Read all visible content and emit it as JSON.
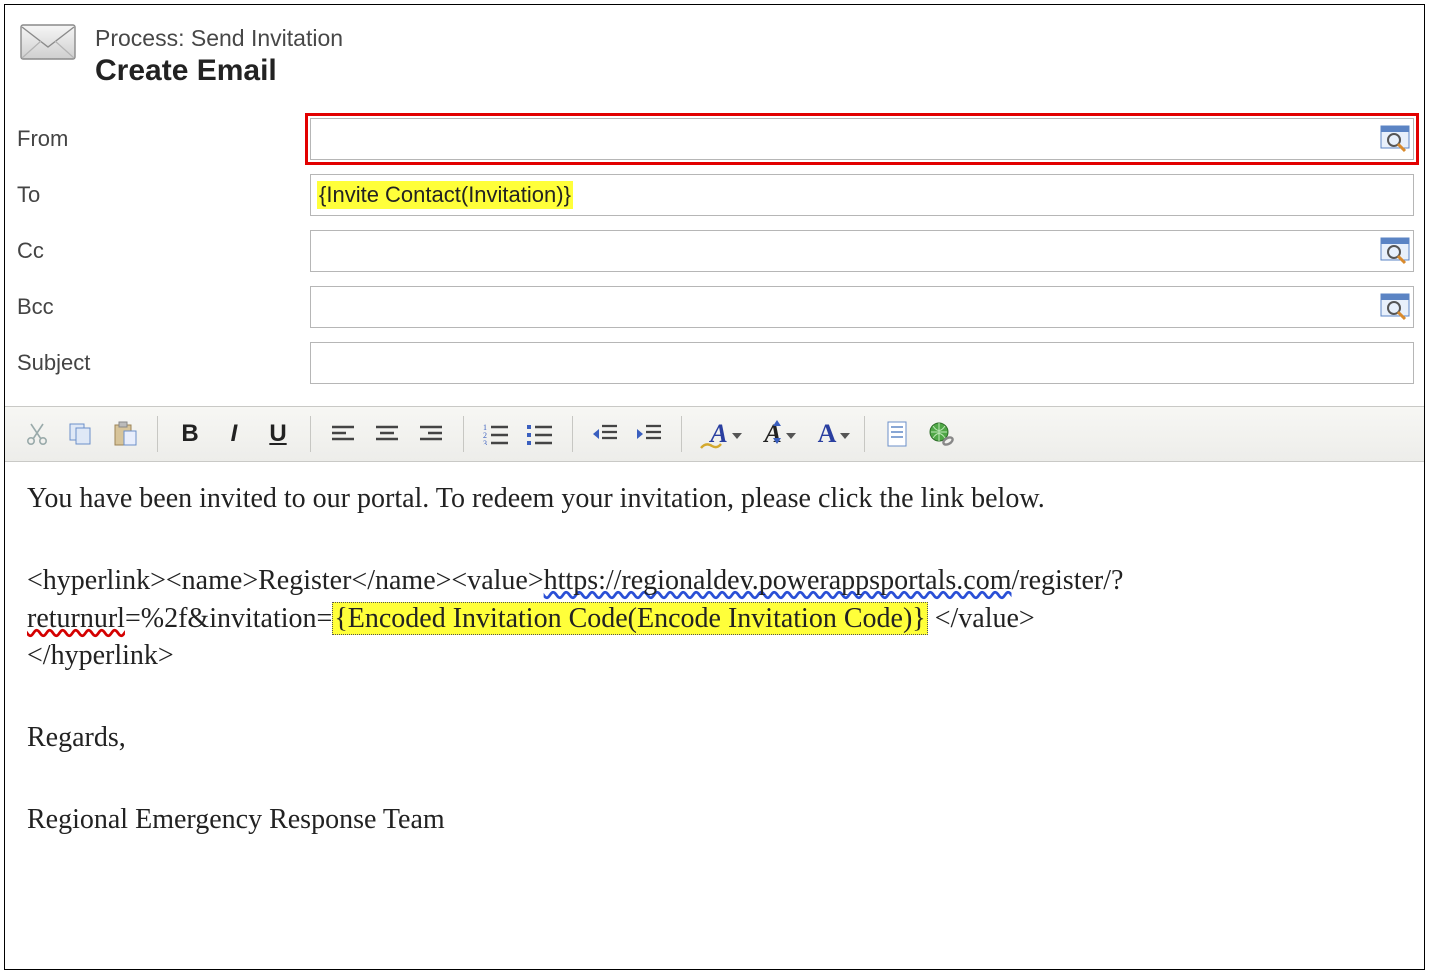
{
  "header": {
    "process": "Process: Send Invitation",
    "title": "Create Email"
  },
  "fields": {
    "from": {
      "label": "From",
      "value": ""
    },
    "to": {
      "label": "To",
      "value": "{Invite Contact(Invitation)}"
    },
    "cc": {
      "label": "Cc",
      "value": ""
    },
    "bcc": {
      "label": "Bcc",
      "value": ""
    },
    "subject": {
      "label": "Subject",
      "value": ""
    }
  },
  "toolbar": {
    "bold": "B",
    "italic": "I",
    "underline": "U",
    "fontBgA": "A",
    "fontSizeA": "A",
    "fontColorA": "A"
  },
  "body": {
    "intro": "You have been invited to our portal. To redeem your invitation, please click the link below.",
    "tag_open_hyperlink": "<hyperlink><name>Register</name><value>",
    "url_host": "https://regionaldev.powerappsportals.com",
    "url_path": "/register/?",
    "url_returnurl_word": "returnurl",
    "url_mid": "=%2f&invitation=",
    "token": "{Encoded Invitation Code(Encode Invitation Code)}",
    "tag_close_value": "  </value>",
    "tag_close_hyperlink": "</hyperlink>",
    "regards": "Regards,",
    "signature": "Regional Emergency Response Team"
  }
}
